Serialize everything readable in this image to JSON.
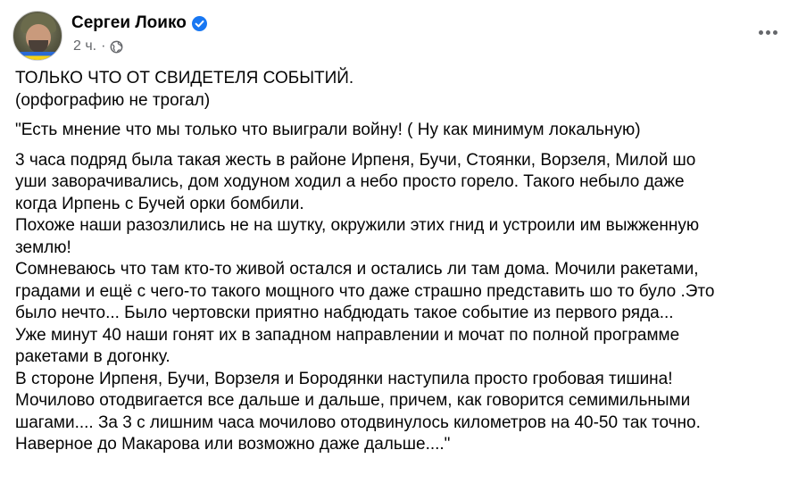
{
  "post": {
    "author": "Сергеи Лоико",
    "time": "2 ч.",
    "separator": "·",
    "verified": true,
    "icons": {
      "verified": "verified-badge-icon",
      "privacy": "globe-icon",
      "more": "more-options-icon"
    },
    "accent_color": "#1877f2",
    "paragraphs": [
      [
        "ТОЛЬКО ЧТО ОТ СВИДЕТЕЛЯ СОБЫТИЙ.",
        "(орфографию не трогал)"
      ],
      [
        "\"Есть мнение что мы только что выиграли войну! ( Ну как минимум локальную)"
      ],
      [
        "3 часа подряд была такая жесть в районе Ирпеня, Бучи, Стоянки, Ворзеля, Милой шо",
        "уши заворачивались, дом ходуном ходил а небо просто горело. Такого небыло даже",
        "когда Ирпень с Бучей орки бомбили.",
        "Похоже наши разозлились не на шутку, окружили этих гнид и устроили им выжженную",
        "землю!",
        "Сомневаюсь что там кто-то живой остался и остались ли там дома. Мочили ракетами,",
        "градами и ещё с чего-то такого мощного что даже страшно представить шо то було .Это",
        "было нечто... Было чертовски приятно набдюдать такое событие из первого ряда...",
        "Уже минут 40 наши гонят их в западном направлении и мочат по полной программе",
        "ракетами в догонку.",
        "В стороне Ирпеня, Бучи, Ворзеля и Бородянки наступила просто гробовая тишина!",
        "Мочилово отодвигается все дальше и дальше, причем, как говорится семимильными",
        "шагами.... За 3 с лишним часа мочилово отодвинулось километров на 40-50 так точно.",
        "Наверное до Макарова или возможно даже дальше....\""
      ]
    ]
  }
}
